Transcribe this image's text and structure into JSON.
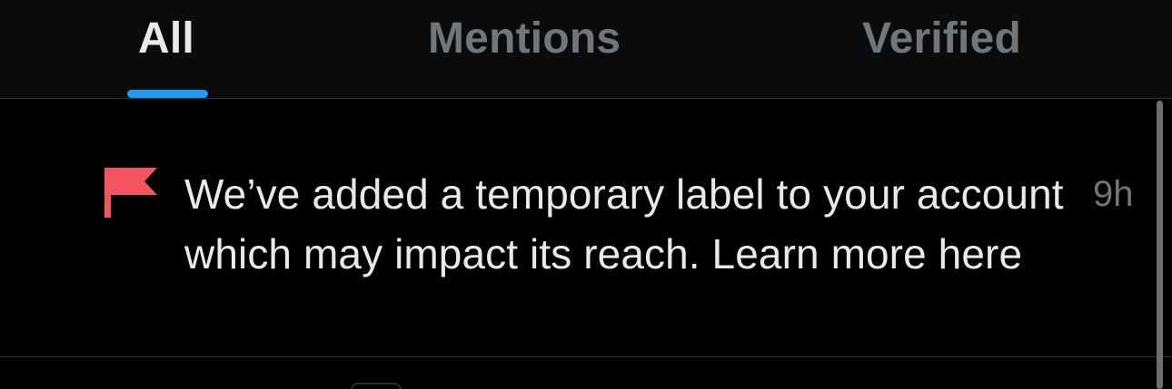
{
  "tabs": [
    {
      "label": "All",
      "selected": true
    },
    {
      "label": "Mentions",
      "selected": false
    },
    {
      "label": "Verified",
      "selected": false
    }
  ],
  "notification": {
    "icon": "flag-icon",
    "text": "We’ve added a temporary label to your account which may impact its reach. Learn more here",
    "time": "9h"
  },
  "colors": {
    "background": "#000000",
    "tab_bar_background": "#0a0b0c",
    "active_text": "#e7e9ea",
    "inactive_text": "#71767b",
    "accent": "#1d9bf0",
    "flag": "#f4535f",
    "divider": "#2f3336"
  }
}
